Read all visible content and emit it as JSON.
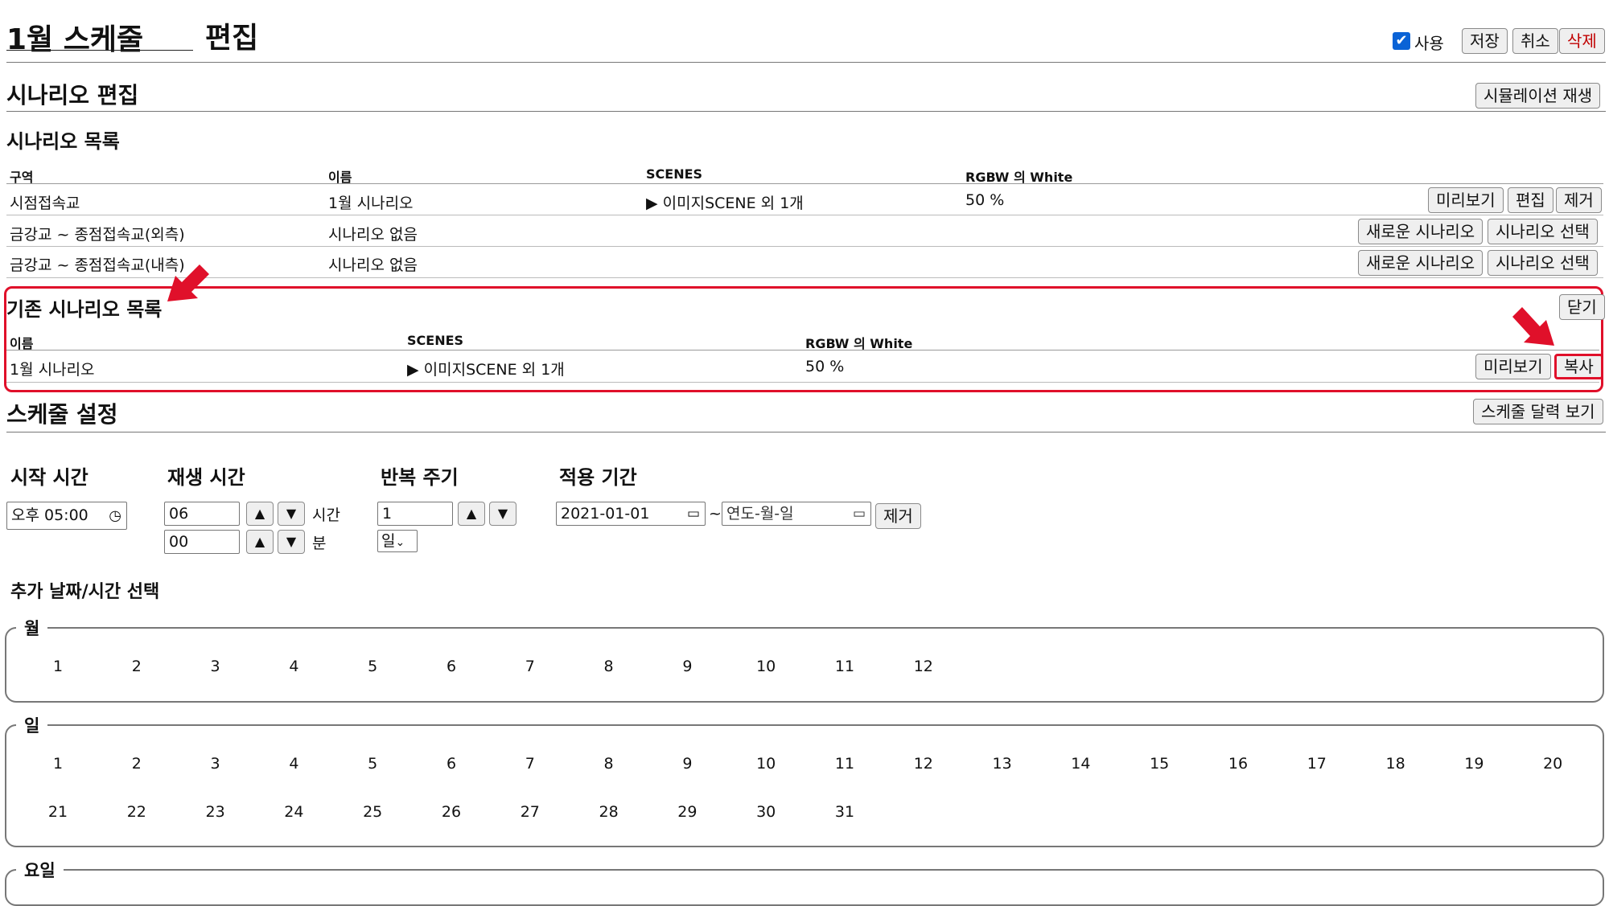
{
  "header": {
    "title": "1월 스케줄",
    "edit_label": "편집",
    "use_label": "사용",
    "save": "저장",
    "cancel": "취소",
    "delete": "삭제"
  },
  "scenario_edit": {
    "title": "시나리오 편집",
    "simulate_button": "시뮬레이션 재생"
  },
  "scenario_list": {
    "title": "시나리오 목록",
    "headers": [
      "구역",
      "이름",
      "SCENES",
      "RGBW 의 White"
    ],
    "rows": [
      {
        "zone": "시점접속교",
        "name": "1월 시나리오",
        "scenes": "▶ 이미지SCENE 외 1개",
        "white": "50 %",
        "buttons": [
          "미리보기",
          "편집",
          "제거"
        ]
      },
      {
        "zone": "금강교 ~ 종점접속교(외측)",
        "name": "시나리오 없음",
        "scenes": "",
        "white": "",
        "buttons": [
          "새로운 시나리오",
          "시나리오 선택"
        ]
      },
      {
        "zone": "금강교 ~ 종점접속교(내측)",
        "name": "시나리오 없음",
        "scenes": "",
        "white": "",
        "buttons": [
          "새로운 시나리오",
          "시나리오 선택"
        ]
      }
    ]
  },
  "existing_list": {
    "title": "기존 시나리오 목록",
    "close": "닫기",
    "headers": [
      "이름",
      "SCENES",
      "RGBW 의 White"
    ],
    "row": {
      "name": "1월 시나리오",
      "scenes": "▶ 이미지SCENE 외 1개",
      "white": "50 %",
      "preview": "미리보기",
      "copy": "복사"
    }
  },
  "schedule": {
    "title": "스케줄 설정",
    "calendar_button": "스케줄 달력 보기",
    "start_time": {
      "label": "시작 시간",
      "value": "오후 05:00"
    },
    "play_time": {
      "label": "재생 시간",
      "hours": "06",
      "hours_unit": "시간",
      "minutes": "00",
      "minutes_unit": "분"
    },
    "repeat": {
      "label": "반복 주기",
      "value": "1",
      "unit": "일"
    },
    "period": {
      "label": "적용 기간",
      "start": "2021-01-01",
      "sep": "~",
      "end_placeholder": "연도-월-일",
      "remove": "제거"
    },
    "extra_title": "추가 날짜/시간 선택",
    "month_legend": "월",
    "months": [
      "1",
      "2",
      "3",
      "4",
      "5",
      "6",
      "7",
      "8",
      "9",
      "10",
      "11",
      "12"
    ],
    "day_legend": "일",
    "days_row1": [
      "1",
      "2",
      "3",
      "4",
      "5",
      "6",
      "7",
      "8",
      "9",
      "10",
      "11",
      "12",
      "13",
      "14",
      "15",
      "16",
      "17",
      "18",
      "19",
      "20"
    ],
    "days_row2": [
      "21",
      "22",
      "23",
      "24",
      "25",
      "26",
      "27",
      "28",
      "29",
      "30",
      "31"
    ],
    "weekday_legend": "요일"
  },
  "colors": {
    "highlight": "#e0102a",
    "delete_text": "#c00000"
  }
}
